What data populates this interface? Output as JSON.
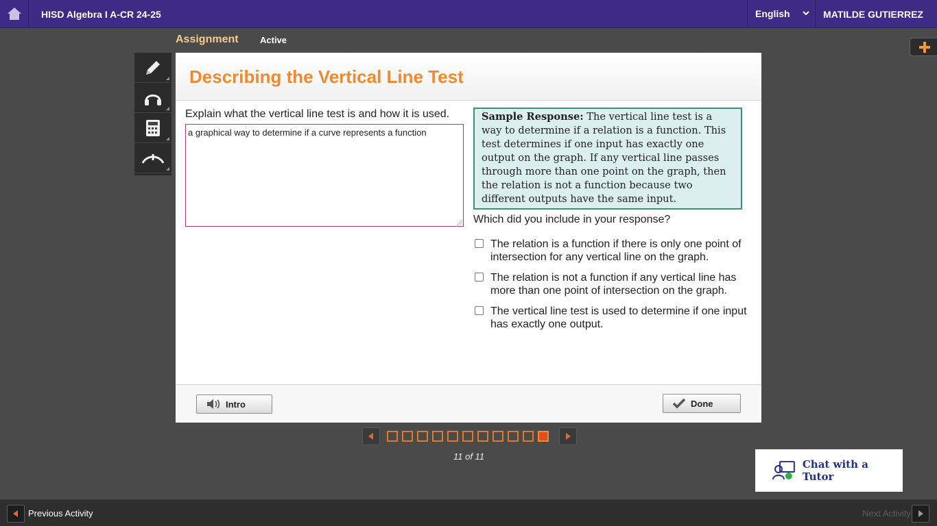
{
  "topbar": {
    "home_icon": "home-icon",
    "course_title": "HISD Algebra I A-CR 24-25",
    "language": "English",
    "user_name": "MATILDE GUTIERREZ"
  },
  "assignment": {
    "label": "Assignment",
    "status": "Active"
  },
  "tools": [
    "pencil-icon",
    "headphones-icon",
    "calculator-icon",
    "collapse-icon"
  ],
  "panel": {
    "title": "Describing the Vertical Line Test",
    "prompt": "Explain what the vertical line test is and how it is used.",
    "answer": "a graphical way to determine if a curve represents a function",
    "sample_label": "Sample Response:",
    "sample_text": " The vertical line test is a way to determine if a relation is a function. This test determines if one input has exactly one output on the graph. If any vertical line passes through more than one point on the graph, then the relation is not a function because two different outputs have the same input.",
    "which_question": "Which did you include in your response?",
    "options": [
      "The relation is a function if there is only one point of intersection for any vertical line on the graph.",
      "The relation is not a function if any vertical line has more than one point of intersection on the graph.",
      "The vertical line test is used to determine if one input has exactly one output."
    ],
    "intro_label": "Intro",
    "done_label": "Done"
  },
  "pager": {
    "total": 11,
    "current": 11,
    "count_text": "11 of 11"
  },
  "chat": {
    "label": "Chat with a Tutor"
  },
  "bottom": {
    "prev_label": "Previous Activity",
    "next_label": "Next Activity"
  },
  "colors": {
    "topbar": "#3d2b85",
    "title_orange": "#f1892d",
    "sample_bg": "#dbeef0",
    "sample_border": "#3c8d82",
    "answer_border": "#b0367f"
  }
}
